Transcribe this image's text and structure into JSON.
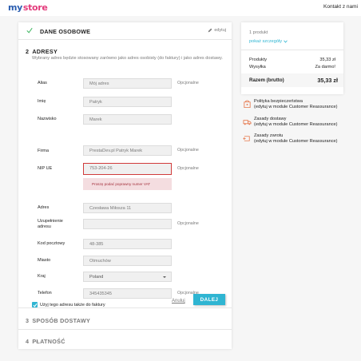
{
  "header": {
    "logo_my": "my",
    "logo_store": "store",
    "contact": "Kontakt z nami"
  },
  "steps": {
    "step1": {
      "title": "DANE OSOBOWE",
      "edit": "edytuj"
    },
    "step2": {
      "number": "2",
      "title": "ADRESY",
      "description": "Wybrany adres będzie stosowany zarówno jako adres osobisty (do faktury) i jako adres dostawy.",
      "fields": {
        "alias": {
          "label": "Alias",
          "value": "Mój adres",
          "note": "Opcjonalne"
        },
        "firstname": {
          "label": "Imię",
          "value": "Patryk"
        },
        "lastname": {
          "label": "Nazwisko",
          "value": "Marek"
        },
        "company": {
          "label": "Firma",
          "value": "PrestaDev.pl Patryk Marek",
          "note": "Opcjonalne"
        },
        "vat": {
          "label": "NIP UE",
          "value": "753-204-26",
          "note": "Opcjonalne",
          "error": "Proszę podać poprawny numer VAT"
        },
        "address1": {
          "label": "Adres",
          "value": "Czesława Miłosza 11"
        },
        "address2": {
          "label": "Uzupełnienie adresu",
          "value": "",
          "note": "Opcjonalne"
        },
        "postcode": {
          "label": "Kod pocztowy",
          "value": "48-385"
        },
        "city": {
          "label": "Miasto",
          "value": "Otmuchów"
        },
        "country": {
          "label": "Kraj",
          "value": "Poland"
        },
        "phone": {
          "label": "Telefon",
          "value": "345435345",
          "note": "Opcjonalne"
        }
      },
      "use_for_invoice": "Użyj tego adresu także do faktury",
      "cancel": "Anuluj",
      "next": "DALEJ"
    },
    "step3": {
      "number": "3",
      "title": "SPOSÓB DOSTAWY"
    },
    "step4": {
      "number": "4",
      "title": "PŁATNOŚĆ"
    }
  },
  "summary": {
    "count": "1 produkt",
    "show_details": "pokaż szczegóły",
    "products_label": "Produkty",
    "products_value": "35,33 zł",
    "shipping_label": "Wysyłka",
    "shipping_value": "Za darmo!",
    "total_label": "Razem (brutto)",
    "total_value": "35,33 zł"
  },
  "reassurance": [
    {
      "icon": "shield-icon",
      "title": "Polityka bezpieczeństwa",
      "note": "(edytuj w module Customer Reassurance)"
    },
    {
      "icon": "truck-icon",
      "title": "Zasady dostawy",
      "note": "(edytuj w module Customer Reassurance)"
    },
    {
      "icon": "return-icon",
      "title": "Zasady zwrotu",
      "note": "(edytuj w module Customer Reassurance)"
    }
  ],
  "colors": {
    "accent": "#2fb5d2",
    "success": "#4cbb6c",
    "error": "#d13b3b",
    "error_bg": "#f4dde0",
    "logo_my": "#2a5db0",
    "logo_store": "#e33a7b"
  }
}
